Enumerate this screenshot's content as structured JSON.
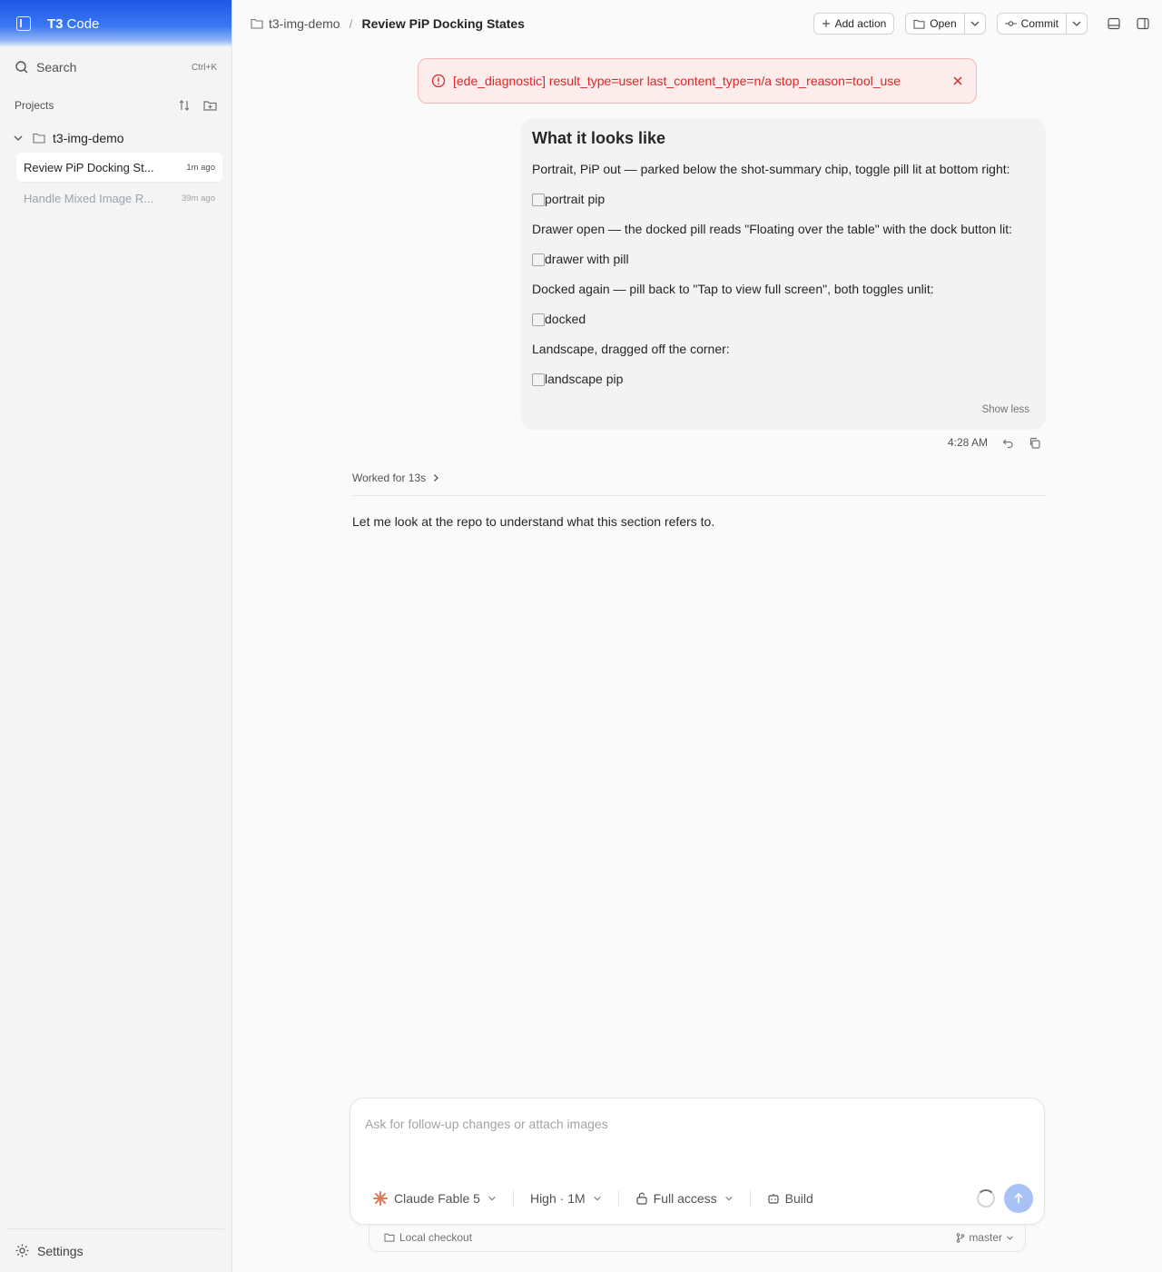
{
  "brand": {
    "bold": "T3",
    "rest": "Code"
  },
  "sidebar": {
    "search_label": "Search",
    "search_shortcut": "Ctrl+K",
    "projects_label": "Projects",
    "project_name": "t3-img-demo",
    "threads": [
      {
        "title": "Review PiP Docking St...",
        "ago": "1m ago"
      },
      {
        "title": "Handle Mixed Image R...",
        "ago": "39m ago"
      }
    ],
    "settings_label": "Settings"
  },
  "topbar": {
    "project": "t3-img-demo",
    "separator": "/",
    "title": "Review PiP Docking States",
    "add_action": "Add action",
    "open": "Open",
    "commit": "Commit"
  },
  "error": {
    "text": "[ede_diagnostic] result_type=user last_content_type=n/a stop_reason=tool_use"
  },
  "message": {
    "heading": "What it looks like",
    "p1": "Portrait, PiP out — parked below the shot-summary chip, toggle pill lit at bottom right:",
    "img1": "portrait pip",
    "p2": "Drawer open — the docked pill reads \"Floating over the table\" with the dock button lit:",
    "img2": "drawer with pill",
    "p3": "Docked again — pill back to \"Tap to view full screen\", both toggles unlit:",
    "img3": "docked",
    "p4": "Landscape, dragged off the corner:",
    "img4": "landscape pip",
    "show_less": "Show less",
    "time": "4:28 AM"
  },
  "worked": {
    "label": "Worked for 13s"
  },
  "assistant": {
    "text": "Let me look at the repo to understand what this section refers to."
  },
  "composer": {
    "placeholder": "Ask for follow-up changes or attach images",
    "model": "Claude Fable 5",
    "effort": "High · 1M",
    "access": "Full access",
    "mode": "Build"
  },
  "footer": {
    "checkout": "Local checkout",
    "branch": "master"
  },
  "colors": {
    "accent": "#2563eb",
    "error": "#dc2626",
    "send": "#a9c2f5"
  }
}
